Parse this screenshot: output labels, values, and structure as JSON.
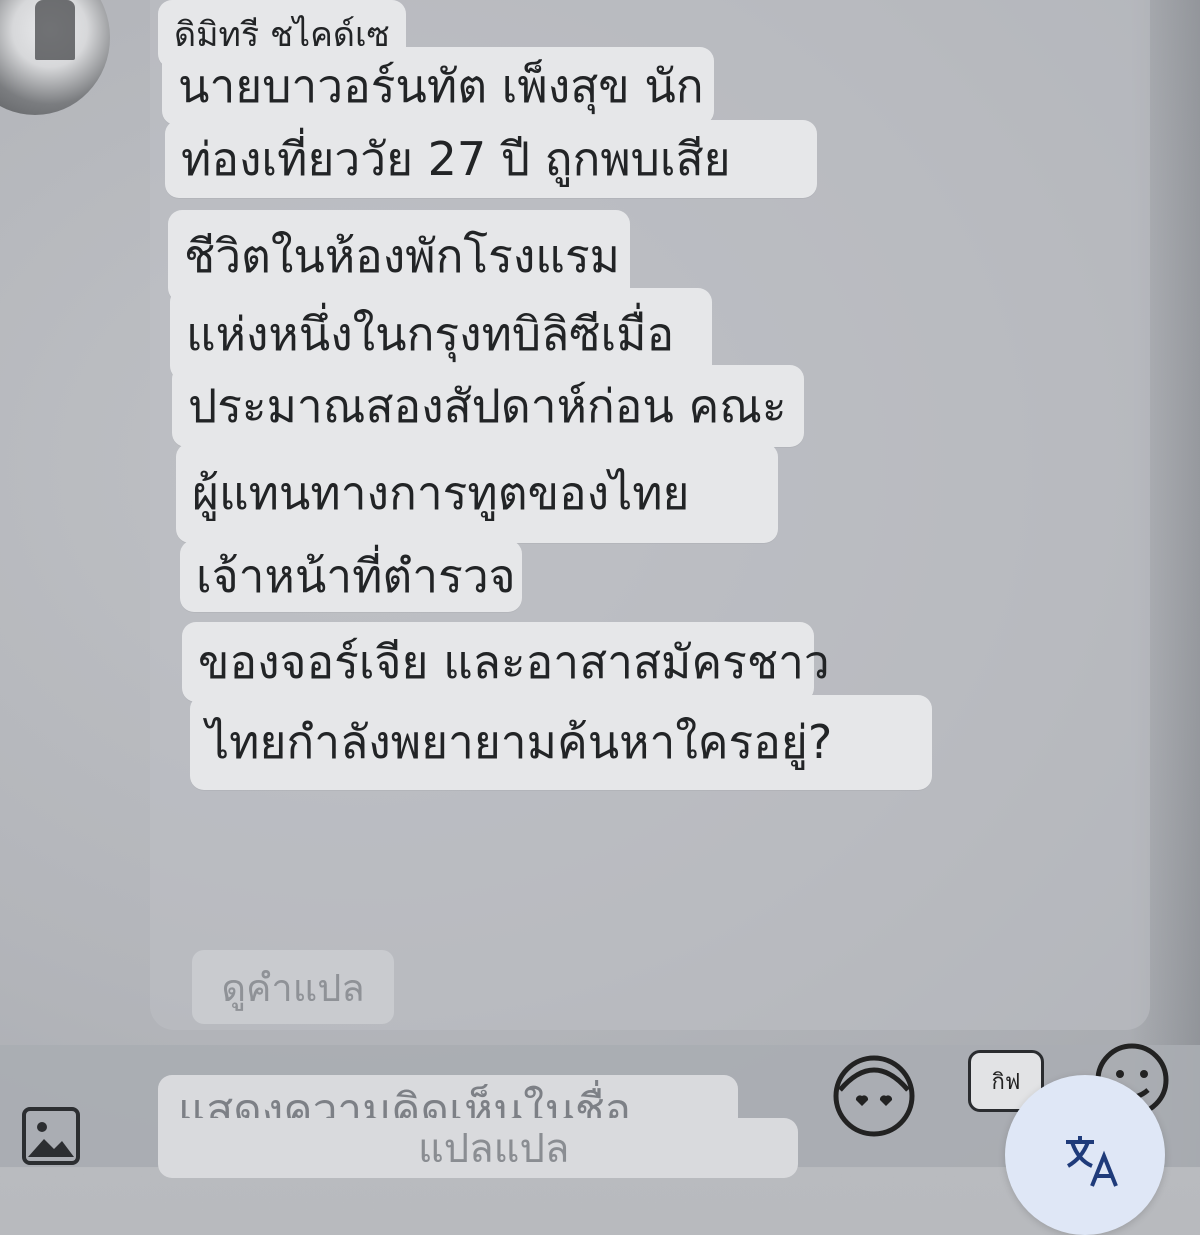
{
  "comment": {
    "author_name": "ดิมิทรี ชไคด์เซ",
    "lines": [
      "นายบาวอร์นทัต เพ็งสุข นัก",
      "ท่องเที่ยววัย 27 ปี ถูกพบเสีย",
      "ชีวิตในห้องพักโรงแรม",
      "แห่งหนึ่งในกรุงทบิลิซีเมื่อ",
      "ประมาณสองสัปดาห์ก่อน คณะ",
      "ผู้แทนทางการทูตของไทย",
      "เจ้าหน้าที่ตำรวจ",
      "ของจอร์เจีย และอาสาสมัครชาว",
      "ไทยกำลังพยายามค้นหาใครอยู่?"
    ],
    "see_translation_label": "ดูคำแปล"
  },
  "composer": {
    "placeholder_line1": "แสดงความคิดเห็นในชื่อ",
    "placeholder_line2": "แปลแปล",
    "gif_label": "กิฟ"
  },
  "icons": {
    "image": "image-icon",
    "avatar_sticker": "avatar-sticker-icon",
    "emoji": "emoji-icon",
    "translate": "translate-icon"
  }
}
